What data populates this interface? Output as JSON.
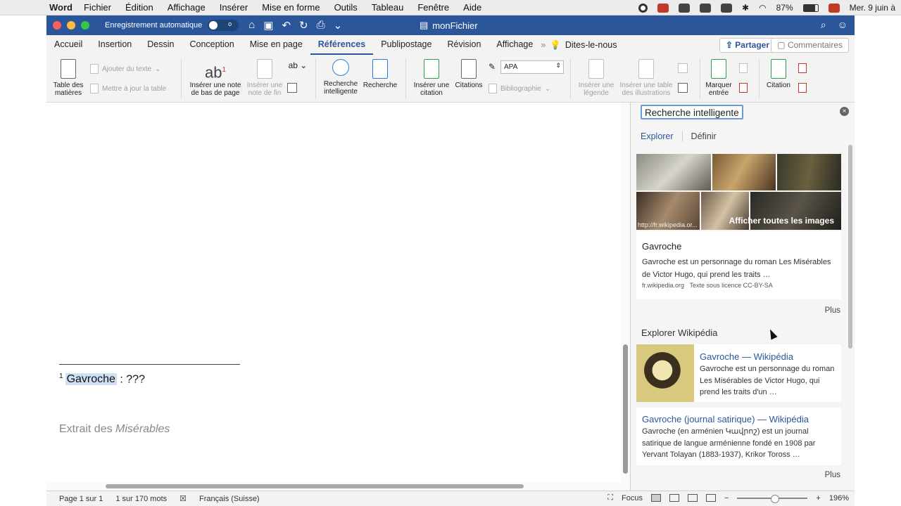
{
  "menubar": {
    "app_name": "Word",
    "items": [
      "Fichier",
      "Édition",
      "Affichage",
      "Insérer",
      "Mise en forme",
      "Outils",
      "Tableau",
      "Fenêtre",
      "Aide"
    ],
    "battery": "87%",
    "datetime": "Mer. 9 juin à"
  },
  "titlebar": {
    "autosave_label": "Enregistrement automatique",
    "autosave_state": "o",
    "doc_title": "monFichier"
  },
  "ribbon_tabs": {
    "tabs": [
      "Accueil",
      "Insertion",
      "Dessin",
      "Conception",
      "Mise en page",
      "Références",
      "Publipostage",
      "Révision",
      "Affichage"
    ],
    "active": "Références",
    "tell_me": "Dites-le-nous",
    "share": "Partager",
    "comments": "Commentaires"
  },
  "ribbon": {
    "toc": "Table des matières",
    "add_text": "Ajouter du texte",
    "update_table": "Mettre à jour la table",
    "insert_footnote": "Insérer une note de bas de page",
    "insert_endnote": "Insérer une note de fin",
    "smart_lookup": "Recherche intelligente",
    "researcher": "Recherche",
    "insert_citation": "Insérer une citation",
    "citations": "Citations",
    "style_value": "APA",
    "bibliography": "Bibliographie",
    "insert_caption": "Insérer une légende",
    "insert_table_figures": "Insérer une table des illustrations",
    "mark_entry": "Marquer entrée",
    "citation": "Citation"
  },
  "document": {
    "footnote_number": "1",
    "footnote_word": "Gavroche",
    "footnote_rest": " : ???",
    "excerpt_prefix": "Extrait des ",
    "excerpt_title": "Misérables"
  },
  "pane": {
    "title": "Recherche intelligente",
    "tabs": [
      "Explorer",
      "Définir"
    ],
    "image_caption": "http://fr.wikipedia.or...",
    "show_all_images": "Afficher toutes les images",
    "result1": {
      "title": "Gavroche",
      "desc": "Gavroche est un personnage du roman Les Misérables de Victor Hugo, qui prend les traits …",
      "source": "fr.wikipedia.org",
      "license": "Texte sous licence CC-BY-SA"
    },
    "plus": "Plus",
    "explore_wiki": "Explorer Wikipédia",
    "wiki1": {
      "title": "Gavroche — Wikipédia",
      "desc": "Gavroche est un personnage du roman Les Misérables de Victor Hugo, qui prend les traits d'un …"
    },
    "wiki2": {
      "title": "Gavroche (journal satirique) — Wikipédia",
      "desc": "Gavroche (en arménien Կավրոշ) est un journal satirique de langue arménienne fondé en 1908 par Yervant Tolayan (1883-1937), Krikor Toross …"
    }
  },
  "statusbar": {
    "page": "Page 1 sur 1",
    "words": "1 sur 170 mots",
    "language": "Français (Suisse)",
    "focus": "Focus",
    "zoom": "196%"
  },
  "colors": {
    "accent": "#2b579a",
    "highlight": "#cfe0f5"
  }
}
